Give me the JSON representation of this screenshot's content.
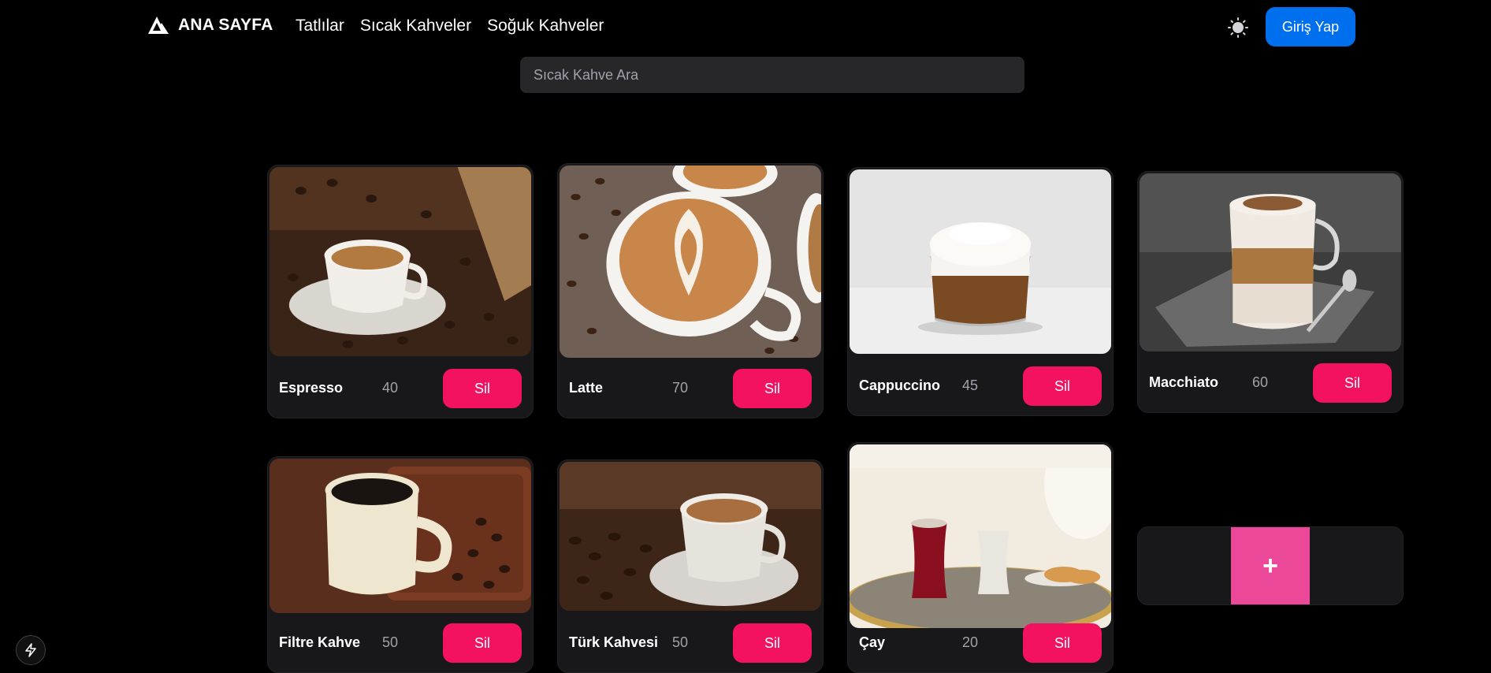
{
  "header": {
    "brand": "ANA SAYFA",
    "nav": [
      "Tatlılar",
      "Sıcak Kahveler",
      "Soğuk Kahveler"
    ],
    "theme_icon": "sun-icon",
    "login_label": "Giriş Yap"
  },
  "search": {
    "placeholder": "Sıcak Kahve Ara",
    "value": ""
  },
  "products": [
    {
      "name": "Espresso",
      "price": "40",
      "action": "Sil"
    },
    {
      "name": "Latte",
      "price": "70",
      "action": "Sil"
    },
    {
      "name": "Cappuccino",
      "price": "45",
      "action": "Sil"
    },
    {
      "name": "Macchiato",
      "price": "60",
      "action": "Sil"
    },
    {
      "name": "Filtre Kahve",
      "price": "50",
      "action": "Sil"
    },
    {
      "name": "Türk Kahvesi",
      "price": "50",
      "action": "Sil"
    },
    {
      "name": "Çay",
      "price": "20",
      "action": "Sil"
    }
  ],
  "add_button": "+",
  "colors": {
    "primary": "#006fee",
    "danger": "#f31260",
    "add": "#ec4899",
    "card": "#18181b"
  }
}
